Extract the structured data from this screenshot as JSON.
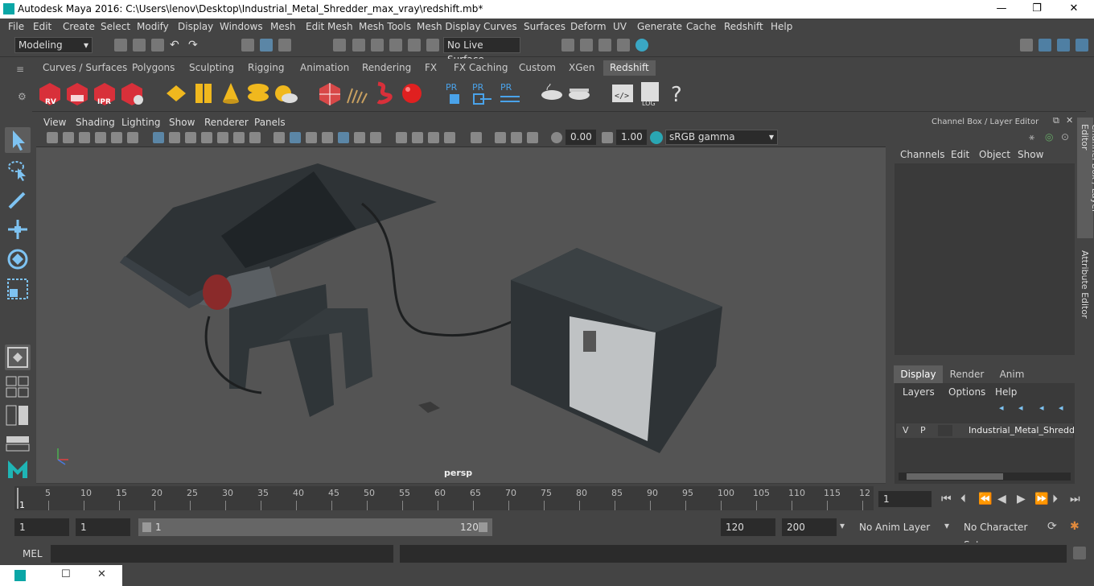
{
  "window": {
    "title": "Autodesk Maya 2016: C:\\Users\\lenov\\Desktop\\Industrial_Metal_Shredder_max_vray\\redshift.mb*",
    "minimize": "—",
    "maximize": "❐",
    "close": "✕"
  },
  "menu": [
    "File",
    "Edit",
    "Create",
    "Select",
    "Modify",
    "Display",
    "Windows",
    "Mesh",
    "Edit Mesh",
    "Mesh Tools",
    "Mesh Display",
    "Curves",
    "Surfaces",
    "Deform",
    "UV",
    "Generate",
    "Cache",
    "Redshift",
    "Help"
  ],
  "status": {
    "mode": "Modeling",
    "live_surface": "No Live Surface"
  },
  "shelf_tabs": [
    "Curves / Surfaces",
    "Polygons",
    "Sculpting",
    "Rigging",
    "Animation",
    "Rendering",
    "FX",
    "FX Caching",
    "Custom",
    "XGen",
    "Redshift"
  ],
  "shelf_active": "Redshift",
  "shelf_icons": {
    "rv": "RV",
    "ipr": "IPR",
    "pr": "PR",
    "log": "LOG",
    "help": "?"
  },
  "viewport": {
    "menus": [
      "View",
      "Shading",
      "Lighting",
      "Show",
      "Renderer",
      "Panels"
    ],
    "exposure": "0.00",
    "gamma": "1.00",
    "colorspace": "sRGB gamma",
    "camera": "persp"
  },
  "channel_box": {
    "title": "Channel Box / Layer Editor",
    "menus": [
      "Channels",
      "Edit",
      "Object",
      "Show"
    ],
    "tabs": [
      "Display",
      "Render",
      "Anim"
    ],
    "active_tab": "Display",
    "layer_menus": [
      "Layers",
      "Options",
      "Help"
    ],
    "layer": {
      "v": "V",
      "p": "P",
      "name": "Industrial_Metal_Shredd"
    }
  },
  "side_tabs": {
    "channel": "Channel Box / Layer Editor",
    "attr": "Attribute Editor"
  },
  "timeline": {
    "ticks": [
      "5",
      "10",
      "15",
      "20",
      "25",
      "30",
      "35",
      "40",
      "45",
      "50",
      "55",
      "60",
      "65",
      "70",
      "75",
      "80",
      "85",
      "90",
      "95",
      "100",
      "105",
      "110",
      "115",
      "12"
    ],
    "start_marker": "1",
    "current_frame": "1"
  },
  "range": {
    "start": "1",
    "start2": "1",
    "slider_start": "1",
    "slider_end": "120",
    "end": "120",
    "end2": "200",
    "anim_layer": "No Anim Layer",
    "char_set": "No Character Set"
  },
  "cmd": {
    "label": "MEL"
  }
}
